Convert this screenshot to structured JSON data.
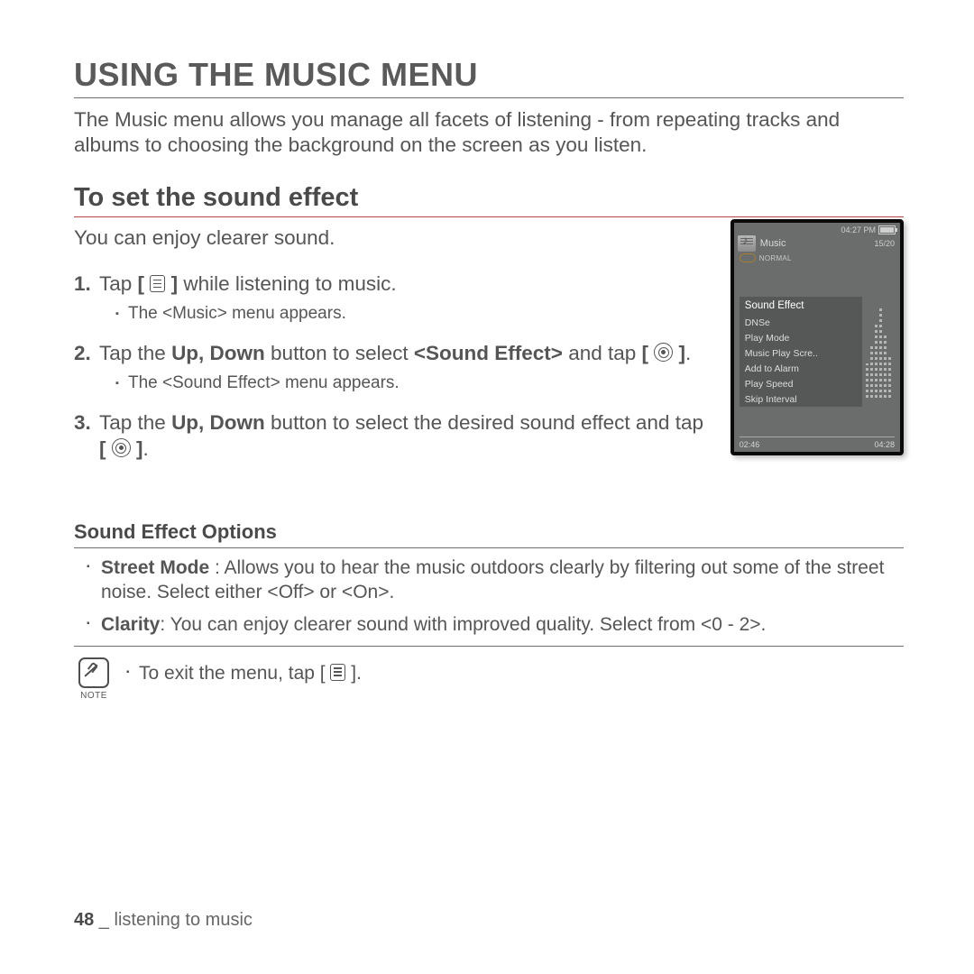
{
  "title": "USING THE MUSIC MENU",
  "intro": "The Music menu allows you manage all facets of listening - from repeating tracks and albums to choosing the background on the screen as you listen.",
  "section_title": "To set the sound effect",
  "lead": "You can enjoy clearer sound.",
  "steps": {
    "s1_pre": "Tap ",
    "s1_post": " while listening to music.",
    "s1_sub": "The <Music> menu appears.",
    "s2_a": "Tap the ",
    "s2_b": "Up, Down",
    "s2_c": " button to select ",
    "s2_d": "<Sound Effect>",
    "s2_e": " and tap ",
    "s2_sub": "The <Sound Effect> menu appears.",
    "s3_a": "Tap the ",
    "s3_b": "Up, Down",
    "s3_c": " button to select the desired sound effect and tap "
  },
  "device": {
    "time": "04:27 PM",
    "title": "Music",
    "count": "15/20",
    "mode": "NORMAL",
    "menu_title": "Sound Effect",
    "menu_items": [
      "DNSe",
      "Play Mode",
      "Music Play Scre..",
      "Add to Alarm",
      "Play Speed",
      "Skip Interval"
    ],
    "time_left": "02:46",
    "time_right": "04:28"
  },
  "options_title": "Sound Effect Options",
  "options": {
    "o1_label": "Street Mode",
    "o1_sep": " : ",
    "o1_text": "Allows you to hear the music outdoors clearly by filtering out some of the street noise. Select either <Off> or <On>.",
    "o2_label": "Clarity",
    "o2_sep": ": ",
    "o2_text": "You can enjoy clearer sound with improved quality. Select from <0 - 2>."
  },
  "note_label": "NOTE",
  "note_pre": "To exit the menu, tap ",
  "note_post": ".",
  "footer": {
    "page": "48",
    "sep": " _ ",
    "chapter": "listening to music"
  },
  "brackets": {
    "open": "[ ",
    "close": " ]",
    "openb": "[",
    "closeb": "]",
    "dot": "."
  }
}
